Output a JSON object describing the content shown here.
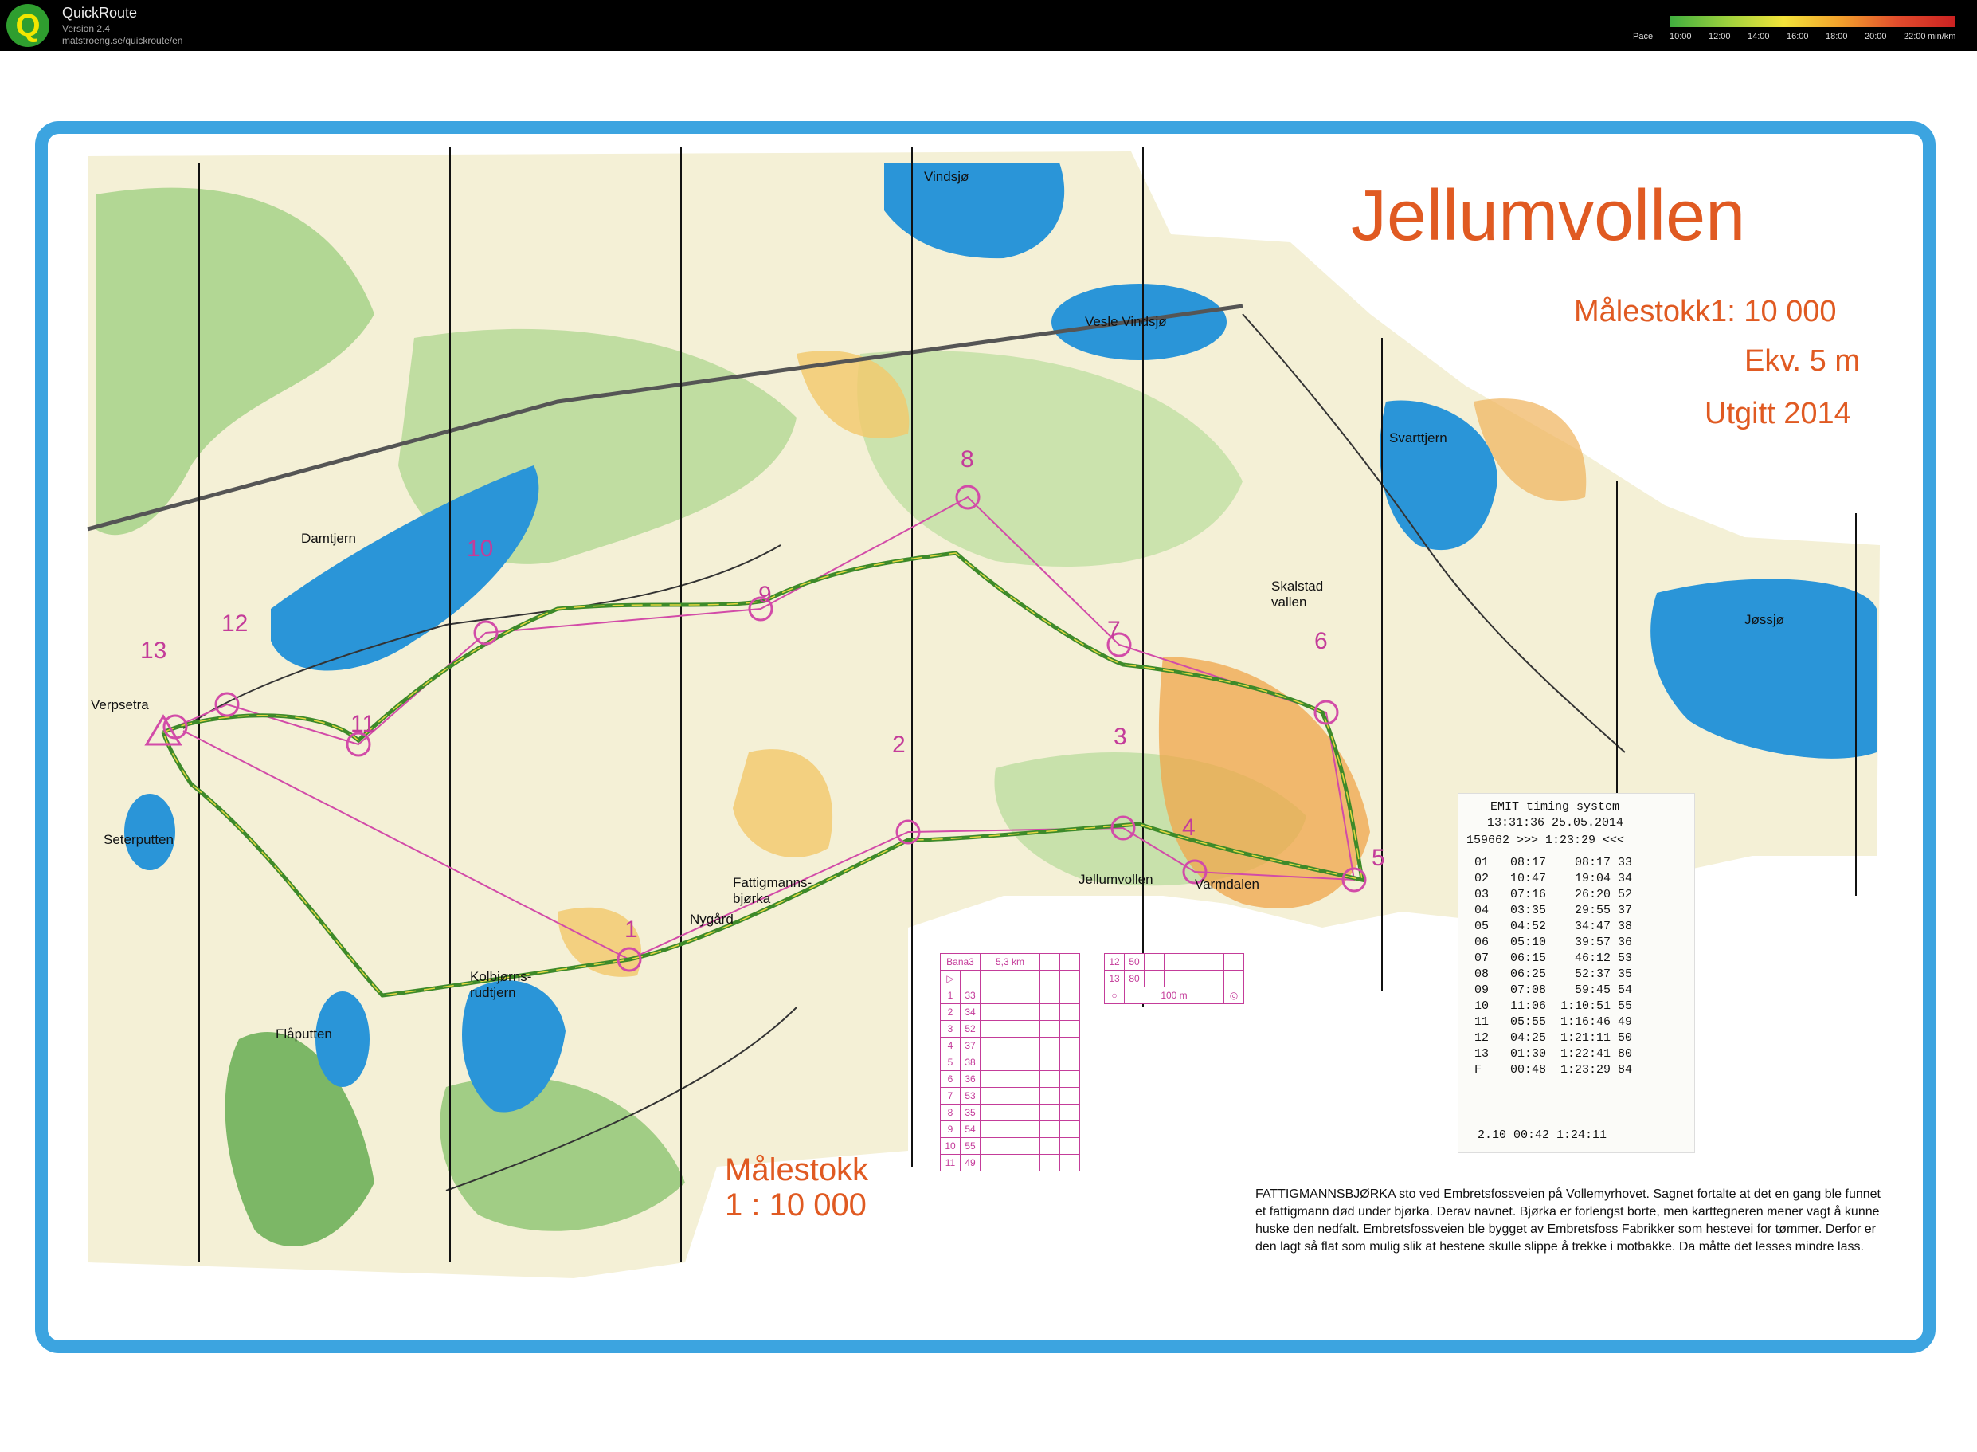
{
  "app": {
    "name": "QuickRoute",
    "version": "Version 2.4",
    "url": "matstroeng.se/quickroute/en",
    "pace_legend": {
      "title": "Pace",
      "ticks": [
        "10:00",
        "12:00",
        "14:00",
        "16:00",
        "18:00",
        "20:00",
        "22:00"
      ],
      "unit": "min/km"
    }
  },
  "map": {
    "title": "Jellumvollen",
    "scale": "Målestokk1: 10 000",
    "contour": "Ekv. 5 m",
    "published": "Utgitt 2014",
    "scale_bottom_label": "Målestokk",
    "scale_bottom_value": "1 : 10 000",
    "places": [
      "Vindsjø",
      "Vesle Vindsjø",
      "Svarttjern",
      "Damtjern",
      "Skalstad vallen",
      "Jøssjø",
      "Verpsetra",
      "Seterputten",
      "Fattigmanns-bjørka",
      "Nygård",
      "Jellumvollen",
      "Varmdalen",
      "Kolbjørns-rudtjern",
      "Flåputten"
    ],
    "control_numbers": [
      "1",
      "2",
      "3",
      "4",
      "5",
      "6",
      "7",
      "8",
      "9",
      "10",
      "11",
      "12",
      "13"
    ],
    "description": "FATTIGMANNSBJØRKA sto ved Embretsfossveien på Vollemyrhovet. Sagnet fortalte at det en gang ble funnet et fattigmann død under bjørka. Derav navnet. Bjørka er forlengst borte, men karttegneren mener vagt å kunne huske den nedfalt. Embretsfossveien ble bygget av Embretsfoss Fabrikker som hestevei for tømmer. Derfor er den lagt så flat som mulig slik at hestene skulle slippe å trekke i motbakke. Da måtte det lesses mindre lass."
  },
  "course_card": {
    "course": "Bana3",
    "length": "5,3 km",
    "controls": [
      {
        "n": "1",
        "code": "33"
      },
      {
        "n": "2",
        "code": "34"
      },
      {
        "n": "3",
        "code": "52"
      },
      {
        "n": "4",
        "code": "37"
      },
      {
        "n": "5",
        "code": "38"
      },
      {
        "n": "6",
        "code": "36"
      },
      {
        "n": "7",
        "code": "53"
      },
      {
        "n": "8",
        "code": "35"
      },
      {
        "n": "9",
        "code": "54"
      },
      {
        "n": "10",
        "code": "55"
      },
      {
        "n": "11",
        "code": "49"
      },
      {
        "n": "12",
        "code": "50"
      },
      {
        "n": "13",
        "code": "80"
      }
    ],
    "finish_distance": "100 m"
  },
  "timing_slip": {
    "system": "EMIT timing system",
    "time_date": "13:31:36 25.05.2014",
    "chip_line": "159662 >>> 1:23:29 <<<",
    "splits": [
      {
        "ctrl": "01",
        "leg": "08:17",
        "total": "08:17",
        "code": "33"
      },
      {
        "ctrl": "02",
        "leg": "10:47",
        "total": "19:04",
        "code": "34"
      },
      {
        "ctrl": "03",
        "leg": "07:16",
        "total": "26:20",
        "code": "52"
      },
      {
        "ctrl": "04",
        "leg": "03:35",
        "total": "29:55",
        "code": "37"
      },
      {
        "ctrl": "05",
        "leg": "04:52",
        "total": "34:47",
        "code": "38"
      },
      {
        "ctrl": "06",
        "leg": "05:10",
        "total": "39:57",
        "code": "36"
      },
      {
        "ctrl": "07",
        "leg": "06:15",
        "total": "46:12",
        "code": "53"
      },
      {
        "ctrl": "08",
        "leg": "06:25",
        "total": "52:37",
        "code": "35"
      },
      {
        "ctrl": "09",
        "leg": "07:08",
        "total": "59:45",
        "code": "54"
      },
      {
        "ctrl": "10",
        "leg": "11:06",
        "total": "1:10:51",
        "code": "55"
      },
      {
        "ctrl": "11",
        "leg": "05:55",
        "total": "1:16:46",
        "code": "49"
      },
      {
        "ctrl": "12",
        "leg": "04:25",
        "total": "1:21:11",
        "code": "50"
      },
      {
        "ctrl": "13",
        "leg": "01:30",
        "total": "1:22:41",
        "code": "80"
      },
      {
        "ctrl": "F",
        "leg": "00:48",
        "total": "1:23:29",
        "code": "84"
      }
    ],
    "extra": "2.10   00:42   1:24:11"
  }
}
